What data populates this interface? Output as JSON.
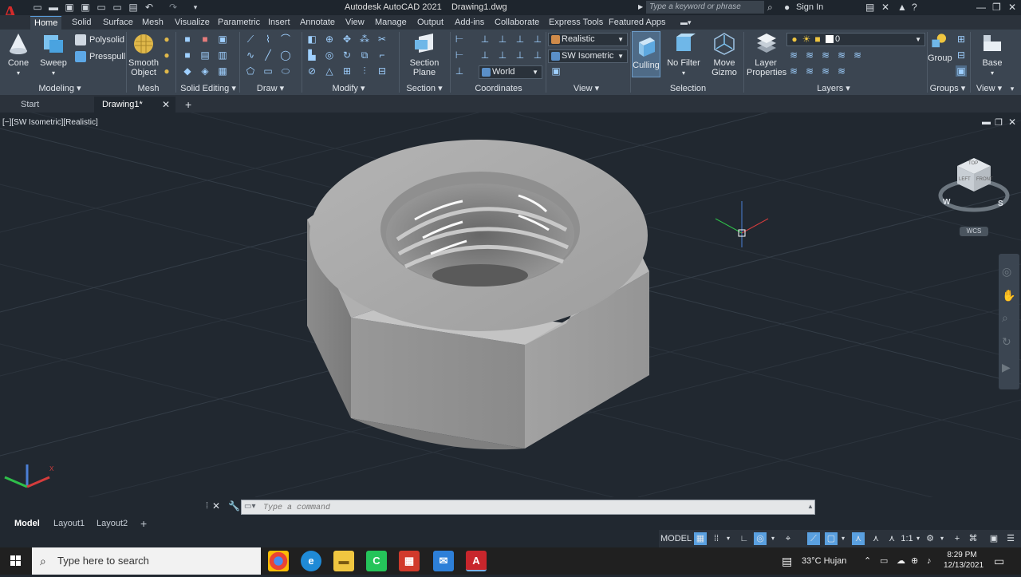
{
  "window": {
    "title": "Autodesk AutoCAD 2021",
    "file": "Drawing1.dwg",
    "search_placeholder": "Type a keyword or phrase",
    "sign_in": "Sign In"
  },
  "ribbon_tabs": [
    "Home",
    "Solid",
    "Surface",
    "Mesh",
    "Visualize",
    "Parametric",
    "Insert",
    "Annotate",
    "View",
    "Manage",
    "Output",
    "Add-ins",
    "Collaborate",
    "Express Tools",
    "Featured Apps"
  ],
  "ribbon": {
    "cone": "Cone",
    "sweep": "Sweep",
    "polysolid": "Polysolid",
    "presspull": "Presspull",
    "smooth_object": "Smooth\nObject",
    "section_plane": "Section\nPlane",
    "visual_style": "Realistic",
    "view_preset": "SW Isometric",
    "ucs": "World",
    "culling": "Culling",
    "no_filter": "No Filter",
    "move_gizmo": "Move\nGizmo",
    "layer_properties": "Layer\nProperties",
    "layer_name": "0",
    "group": "Group",
    "base": "Base",
    "panels": {
      "modeling": "Modeling",
      "mesh": "Mesh",
      "solid_editing": "Solid Editing",
      "draw": "Draw",
      "modify": "Modify",
      "section": "Section",
      "coordinates": "Coordinates",
      "view": "View",
      "selection": "Selection",
      "layers": "Layers",
      "groups": "Groups",
      "view2": "View"
    }
  },
  "file_tabs": {
    "start": "Start",
    "drawing": "Drawing1*"
  },
  "viewport": {
    "label": "[−][SW Isometric][Realistic]",
    "viewcube": {
      "top": "TOP",
      "left": "LEFT",
      "front": "FRONT",
      "w": "W",
      "s": "S",
      "wcs": "WCS"
    }
  },
  "command": {
    "placeholder": "Type a command"
  },
  "layout_tabs": [
    "Model",
    "Layout1",
    "Layout2"
  ],
  "status": {
    "model": "MODEL",
    "scale": "1:1"
  },
  "taskbar": {
    "search": "Type here to search",
    "weather": "33°C  Hujan",
    "time": "8:29 PM",
    "date": "12/13/2021"
  },
  "colors": {
    "accent": "#5aa0e0",
    "autocad_red": "#d52b2b"
  }
}
